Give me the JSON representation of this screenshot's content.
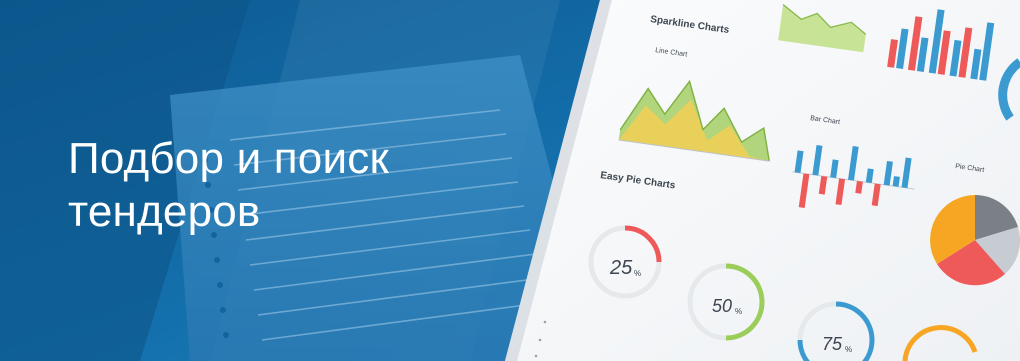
{
  "headline": {
    "line1": "Подбор и поиск",
    "line2": "тендеров"
  },
  "dashboard": {
    "sparkline_title": "Sparkline Charts",
    "line_chart_label": "Line Chart",
    "bar_chart_label": "Bar Chart",
    "easy_pie_title": "Easy Pie Charts",
    "pie_chart_label": "Pie Chart",
    "pie_25": "25",
    "pie_50": "50",
    "pie_75": "75",
    "pct": "%"
  },
  "colors": {
    "blue_dark": "#0f5f98",
    "blue": "#1a7fc0",
    "chart_red": "#ee5a5a",
    "chart_blue": "#3b9bd1",
    "chart_green": "#9bcd5a",
    "chart_yellow": "#f2cf56",
    "chart_orange": "#f6a623",
    "chart_gray": "#7b7f86"
  }
}
